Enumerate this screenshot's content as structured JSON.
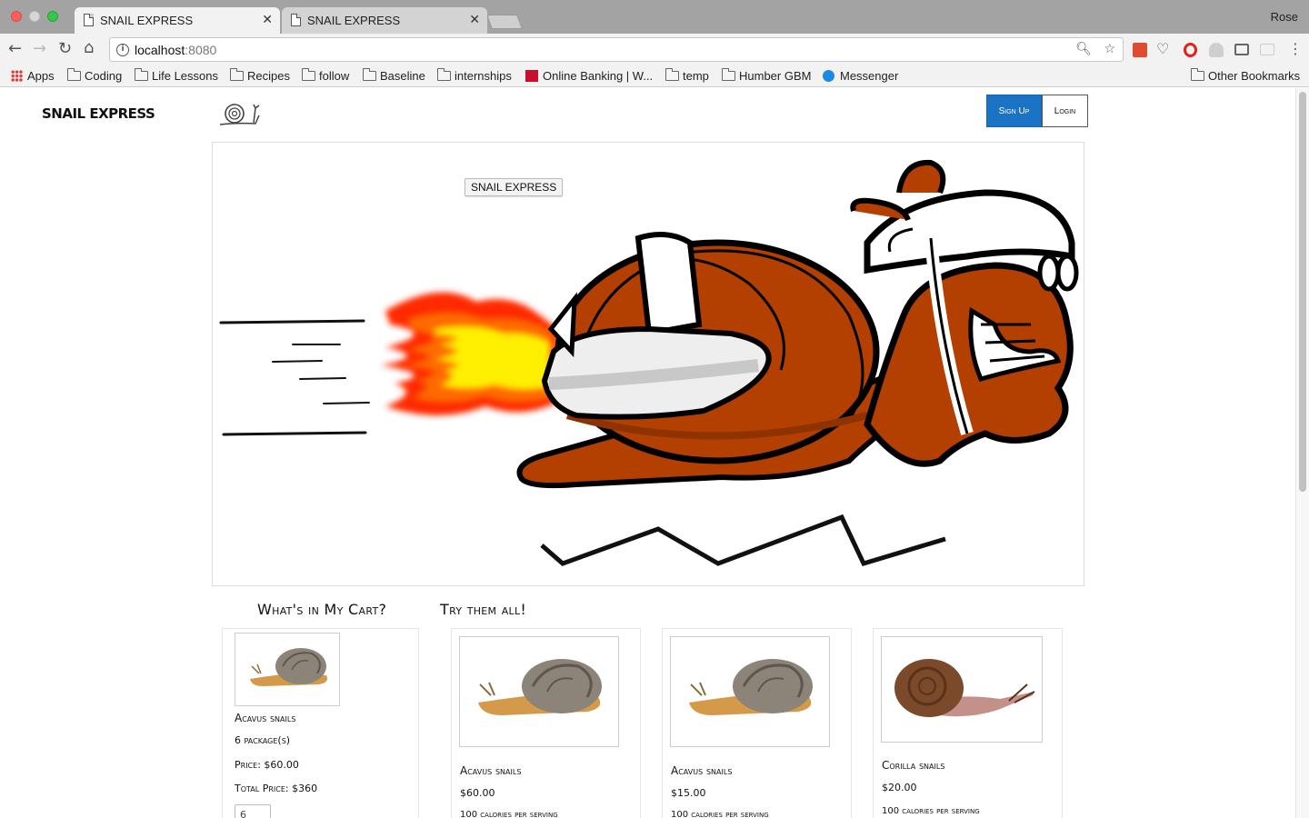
{
  "browser": {
    "tabs": [
      {
        "title": "SNAIL EXPRESS",
        "active": true
      },
      {
        "title": "SNAIL EXPRESS",
        "active": false
      }
    ],
    "profile_name": "Rose",
    "url_host": "localhost",
    "url_port": ":8080",
    "bookmarks": [
      "Apps",
      "Coding",
      "Life Lessons",
      "Recipes",
      "follow",
      "Baseline",
      "internships",
      "Online Banking | W...",
      "temp",
      "Humber GBM",
      "Messenger"
    ],
    "other_bookmarks": "Other Bookmarks"
  },
  "header": {
    "brand": "SNAIL EXPRESS",
    "signup_label": "Sign Up",
    "login_label": "Login"
  },
  "hero": {
    "badge": "SNAIL EXPRESS"
  },
  "cart": {
    "title": "What's in My Cart?",
    "item": {
      "name": "Acavus snails",
      "packages": "6 package(s)",
      "price": "Price: $60.00",
      "total": "Total Price: $360",
      "qty": "6"
    }
  },
  "catalog": {
    "title": "Try them all!",
    "products": [
      {
        "name": "Acavus snails",
        "price": "$60.00",
        "calories": "100 calories per serving"
      },
      {
        "name": "Acavus snails",
        "price": "$15.00",
        "calories": "100 calories per serving"
      },
      {
        "name": "Corilla snails",
        "price": "$20.00",
        "calories": "100 calories per serving"
      }
    ]
  },
  "colors": {
    "signup_bg": "#1a73c4",
    "snail_body": "#b34000",
    "flame_red": "#ff2a00",
    "flame_yellow": "#ffef00"
  }
}
